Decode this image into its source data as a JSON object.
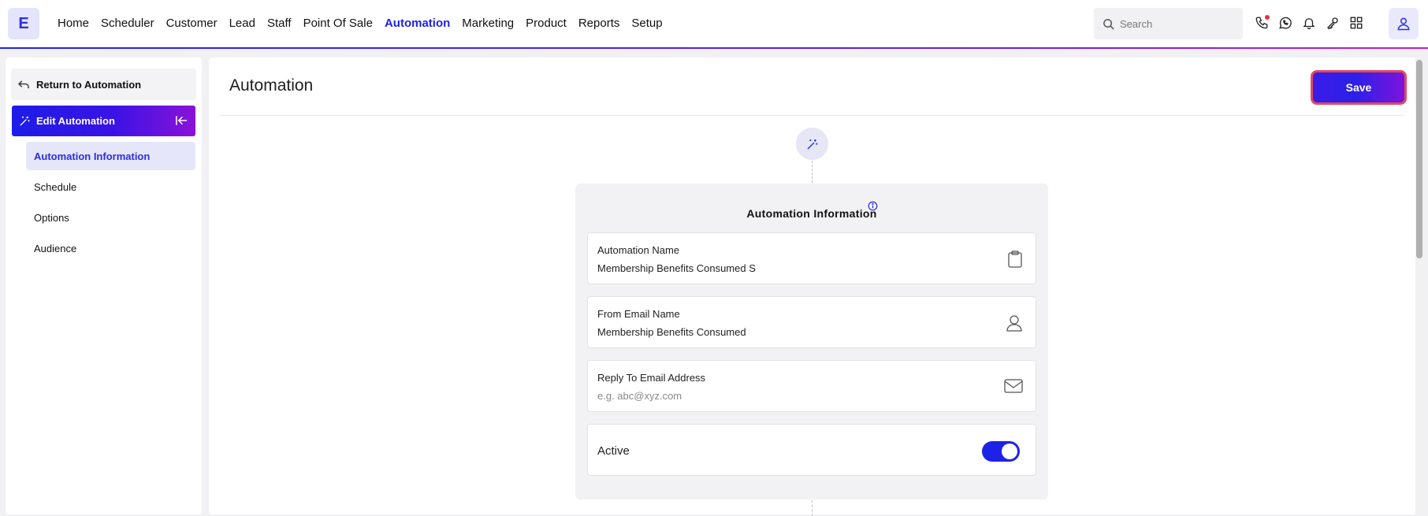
{
  "app": {
    "logo_letter": "E"
  },
  "nav": {
    "items": [
      {
        "label": "Home"
      },
      {
        "label": "Scheduler"
      },
      {
        "label": "Customer"
      },
      {
        "label": "Lead"
      },
      {
        "label": "Staff"
      },
      {
        "label": "Point Of Sale"
      },
      {
        "label": "Automation",
        "active": true
      },
      {
        "label": "Marketing"
      },
      {
        "label": "Product"
      },
      {
        "label": "Reports"
      },
      {
        "label": "Setup"
      }
    ],
    "search_placeholder": "Search",
    "icons": [
      "phone-icon",
      "whatsapp-icon",
      "bell-icon",
      "key-icon",
      "apps-grid-icon",
      "user-icon"
    ]
  },
  "sidebar": {
    "return_label": "Return to Automation",
    "section_title": "Edit Automation",
    "items": [
      {
        "label": "Automation Information",
        "active": true
      },
      {
        "label": "Schedule"
      },
      {
        "label": "Options"
      },
      {
        "label": "Audience"
      }
    ]
  },
  "main": {
    "title": "Automation",
    "save_label": "Save",
    "card": {
      "title": "Automation Information",
      "fields": {
        "automation_name": {
          "label": "Automation Name",
          "value": "Membership Benefits Consumed S"
        },
        "from_email_name": {
          "label": "From Email Name",
          "value": "Membership Benefits Consumed"
        },
        "reply_to_email": {
          "label": "Reply To Email Address",
          "value": "",
          "placeholder": "e.g. abc@xyz.com"
        },
        "active": {
          "label": "Active",
          "on": true
        }
      }
    }
  },
  "colors": {
    "accent": "#1f24e8",
    "accent_purple": "#8a12d8",
    "save_border": "#e14a5e"
  }
}
